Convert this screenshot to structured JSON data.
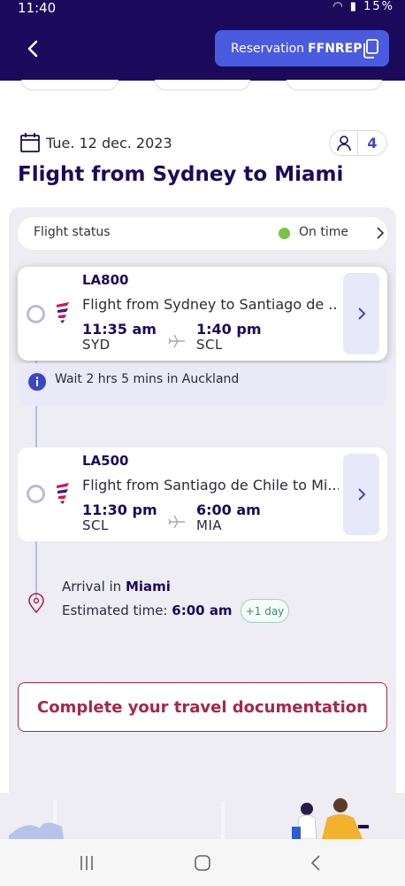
{
  "status_bar": {
    "time": "11:40",
    "battery": "15%"
  },
  "header": {
    "reservation_label": "Reservation",
    "reservation_code": "FFNREP"
  },
  "trip": {
    "date": "Tue. 12 dec. 2023",
    "passengers": "4",
    "title": "Flight from Sydney to Miami"
  },
  "flight_status": {
    "label": "Flight status",
    "value": "On time"
  },
  "flights": [
    {
      "code": "LA800",
      "route": "Flight from Sydney to Santiago de ...",
      "dep_time": "11:35 am",
      "dep_code": "SYD",
      "arr_time": "1:40 pm",
      "arr_code": "SCL"
    },
    {
      "code": "LA500",
      "route": "Flight from Santiago de Chile to Mi...",
      "dep_time": "11:30 pm",
      "dep_code": "SCL",
      "arr_time": "6:00 am",
      "arr_code": "MIA"
    }
  ],
  "layover": {
    "text": "Wait 2 hrs 5 mins in Auckland"
  },
  "arrival": {
    "prefix": "Arrival in",
    "city": "Miami",
    "time_label": "Estimated time:",
    "time": "6:00 am",
    "day_offset": "+1 day"
  },
  "documentation_button": "Complete your travel documentation"
}
